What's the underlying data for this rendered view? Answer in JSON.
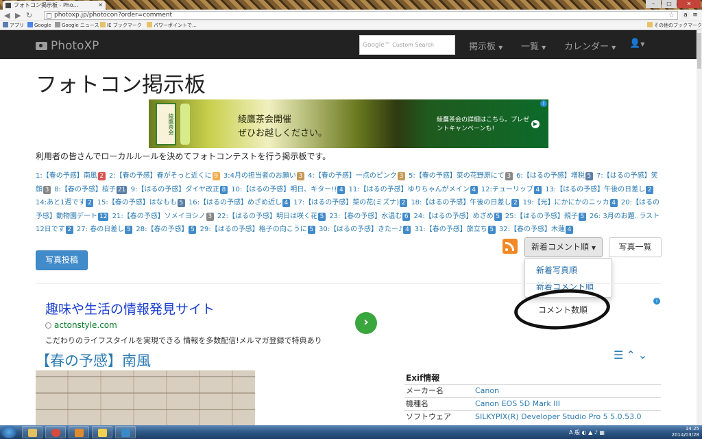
{
  "browser": {
    "tab_title": "フォトコン掲示板 - Pho...",
    "url": "photoxp.jp/photocon?order=comment",
    "bookmarks": [
      "アプリ",
      "Google",
      "Google ニュース",
      "IE ブックマーク",
      "パワーポイントで…"
    ],
    "other_bookmarks": "その他のブックマーク"
  },
  "site": {
    "brand": "PhotoXP",
    "search_placeholder": "Custom Search",
    "search_google": "Google™",
    "nav": [
      "掲示板",
      "一覧",
      "カレンダー"
    ]
  },
  "page": {
    "title": "フォトコン掲示板",
    "description": "利用者の皆さんでローカルルールを決めてフォトコンテストを行う掲示板です。"
  },
  "ad_top": {
    "bottle_label": "綾鷹茶会",
    "line1": "綾鷹茶会開催",
    "line2": "ぜひお越しください。",
    "right_text": "綾鷹茶会の詳細はこちら。プレゼントキャンペーンも!"
  },
  "contests": [
    {
      "label": "1:【春の予感】南風",
      "count": "2",
      "color": "#d9534f"
    },
    {
      "label": "2:【春の予感】春がそっと近くに",
      "count": "9",
      "color": "#f0ad4e"
    },
    {
      "label": "3:4月の担当者のお願い",
      "count": "3",
      "color": "#c49a57"
    },
    {
      "label": "4:【春の予感】一点のピンク",
      "count": "3",
      "color": "#c49a57"
    },
    {
      "label": "5:【春の予感】菜の花野原にて",
      "count": "3",
      "color": "#888888"
    },
    {
      "label": "6:【はるの予感】増税",
      "count": "5",
      "color": "#5b7fa6"
    },
    {
      "label": "7:【はるの予感】笑顔",
      "count": "3",
      "color": "#888888"
    },
    {
      "label": "8:【春の予感】桜子",
      "count": "21",
      "color": "#5b7fa6"
    },
    {
      "label": "9:【はるの予感】ダイヤ改正",
      "count": "8",
      "color": "#428bca"
    },
    {
      "label": "10:【はるの予感】明日、キター!!",
      "count": "4",
      "color": "#428bca"
    },
    {
      "label": "11:【はるの予感】ゆりちゃんがメイン",
      "count": "4",
      "color": "#428bca"
    },
    {
      "label": "12:チューリップ",
      "count": "4",
      "color": "#428bca"
    },
    {
      "label": "13:【はるの予感】午後の日差し",
      "count": "2",
      "color": "#428bca"
    },
    {
      "label": "14:あと1週です",
      "count": "2",
      "color": "#428bca"
    },
    {
      "label": "15:【春の予感】はなもも",
      "count": "5",
      "color": "#5b7fa6"
    },
    {
      "label": "16:【はるの予感】めざめ近し",
      "count": "4",
      "color": "#428bca"
    },
    {
      "label": "17:【はるの予感】菜の花(ミズナ)",
      "count": "2",
      "color": "#428bca"
    },
    {
      "label": "18:【はるの予感】午後の日差し",
      "count": "2",
      "color": "#428bca"
    },
    {
      "label": "19:【光】にかにかのニッカ",
      "count": "4",
      "color": "#428bca"
    },
    {
      "label": "20:【はるの予感】動物園デート",
      "count": "12",
      "color": "#428bca"
    },
    {
      "label": "21:【春の予感】ソメイヨシノ",
      "count": "3",
      "color": "#888888"
    },
    {
      "label": "22:【はるの予感】明日は咲く花",
      "count": "5",
      "color": "#428bca"
    },
    {
      "label": "23:【春の予感】水温む",
      "count": "6",
      "color": "#428bca"
    },
    {
      "label": "24:【はるの予感】めざめ",
      "count": "5",
      "color": "#428bca"
    },
    {
      "label": "25:【はるの予感】親子",
      "count": "5",
      "color": "#428bca"
    },
    {
      "label": "26: 3月のお題‥ラスト12日です",
      "count": "2",
      "color": "#428bca"
    },
    {
      "label": "27: 春の日差し",
      "count": "5",
      "color": "#428bca"
    },
    {
      "label": "28:【春の予感】",
      "count": "5",
      "color": "#428bca"
    },
    {
      "label": "29:【はるの予感】格子の向こうに",
      "count": "5",
      "color": "#428bca"
    },
    {
      "label": "30:【はるの予感】きたー♪",
      "count": "4",
      "color": "#428bca"
    },
    {
      "label": "31:【春の予感】旅立ち",
      "count": "5",
      "color": "#428bca"
    },
    {
      "label": "32:【春の予感】木蓮",
      "count": "4",
      "color": "#428bca"
    }
  ],
  "actions": {
    "post_button": "写真投稿",
    "sort_button": "新着コメント順",
    "photos_button": "写真一覧",
    "sort_menu": [
      "新着写真順",
      "新着コメント順"
    ],
    "sort_extra": "コメント数順"
  },
  "ad_text": {
    "title": "趣味や生活の情報発見サイト",
    "url": "actonstyle.com",
    "body": "こだわりのライフスタイルを実現できる 情報を多数配信!メルマガ登録で特典あり"
  },
  "post": {
    "title": "【春の予感】南風",
    "exif_heading": "Exif情報",
    "exif": [
      {
        "key": "メーカー名",
        "value": "Canon"
      },
      {
        "key": "機種名",
        "value": "Canon EOS 5D Mark III"
      },
      {
        "key": "ソフトウェア",
        "value": "SILKYPIX(R) Developer Studio Pro 5 5.0.53.0"
      }
    ]
  },
  "taskbar": {
    "time": "14:25",
    "date": "2014/03/28",
    "lang": "A 般"
  }
}
